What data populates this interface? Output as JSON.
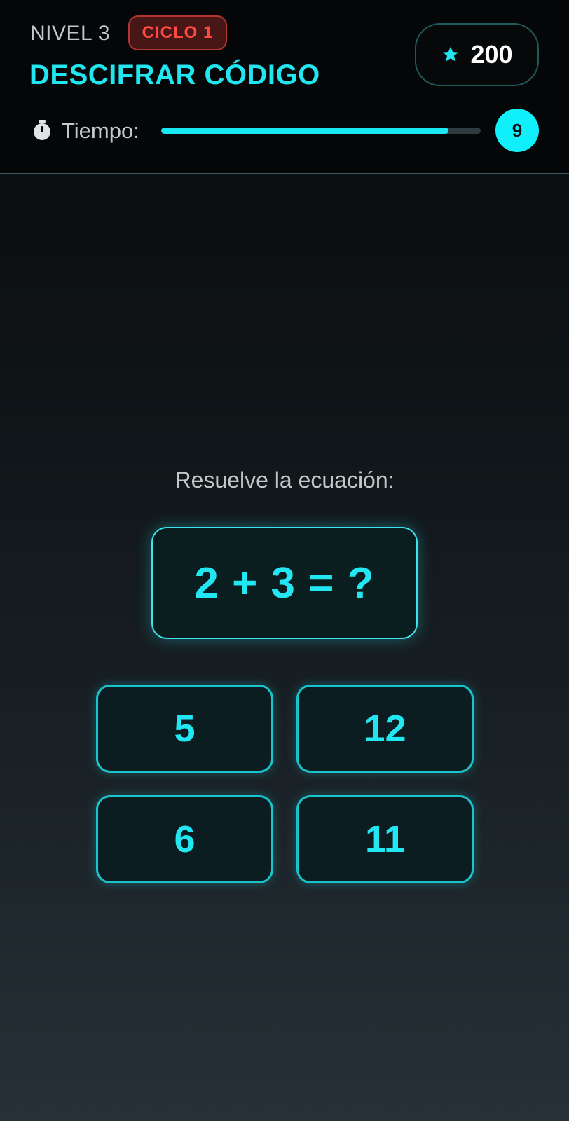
{
  "header": {
    "level_label": "NIVEL 3",
    "cycle_badge": "CICLO 1",
    "title": "DESCIFRAR CÓDIGO",
    "score": "200",
    "timer_label": "Tiempo:",
    "time_remaining": "9",
    "time_progress": 0.9
  },
  "main": {
    "prompt": "Resuelve la ecuación:",
    "equation": "2 + 3 = ?",
    "options": [
      "5",
      "12",
      "6",
      "11"
    ]
  },
  "icons": {
    "score": "star-icon",
    "timer": "stopwatch-icon"
  },
  "colors": {
    "accent": "#22e6f2",
    "badge_text": "#ff4a3f",
    "badge_background": "#471617",
    "timer_fill": "#19e8f2"
  }
}
